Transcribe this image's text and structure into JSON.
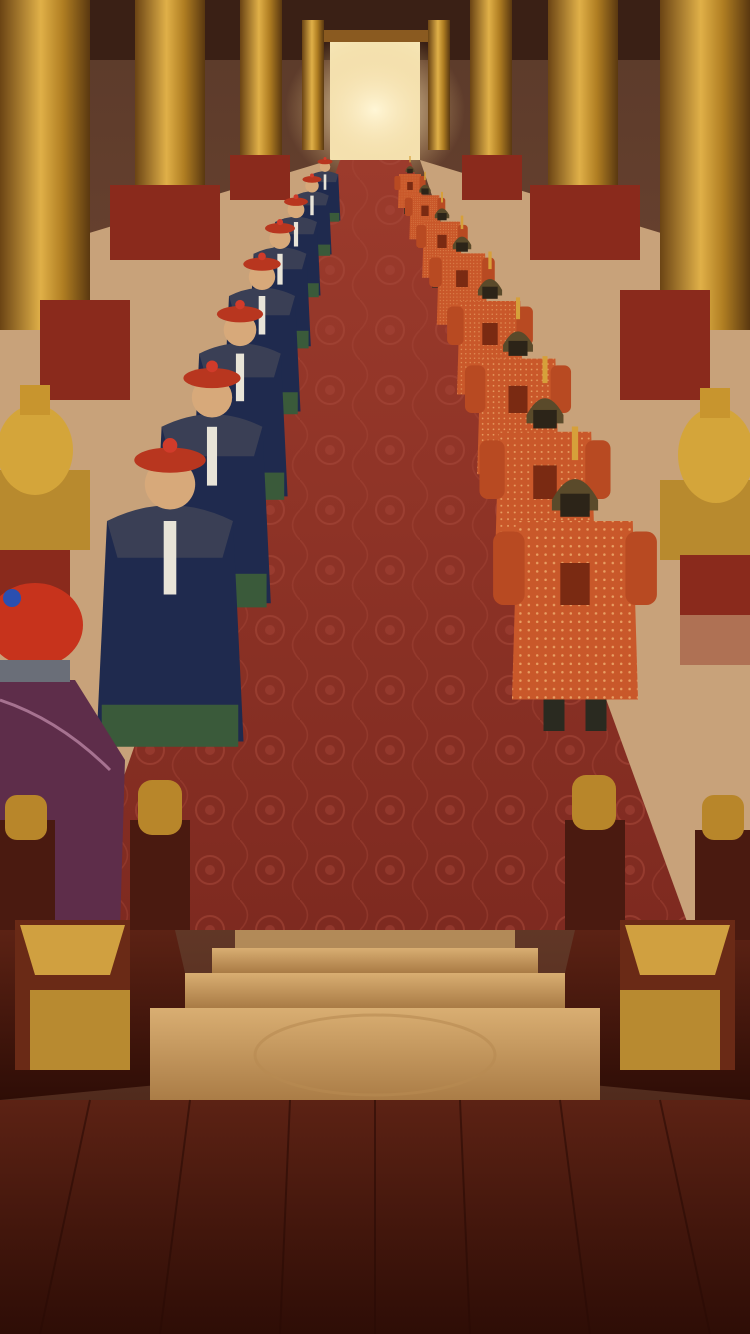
{
  "scene": {
    "name": "imperial-throne-hall",
    "description_icons": [
      "dragon-pillar-icon",
      "guard-icon",
      "official-icon",
      "lion-statue-icon",
      "incense-burner-icon"
    ]
  },
  "palette": {
    "carpet": "#8e2f25",
    "carpet_dark": "#6e2119",
    "floor": "#c8a27a",
    "gold": "#c8952e",
    "gold_dark": "#7a5418",
    "robe_blue": "#1f2a4e",
    "armor_orange": "#c9582a",
    "hat_red": "#b8361f",
    "wood": "#4a1a10",
    "step": "#c79a62",
    "doorway": "#f6e7b8"
  },
  "officials": {
    "count": 8
  },
  "guards": {
    "count": 8
  }
}
